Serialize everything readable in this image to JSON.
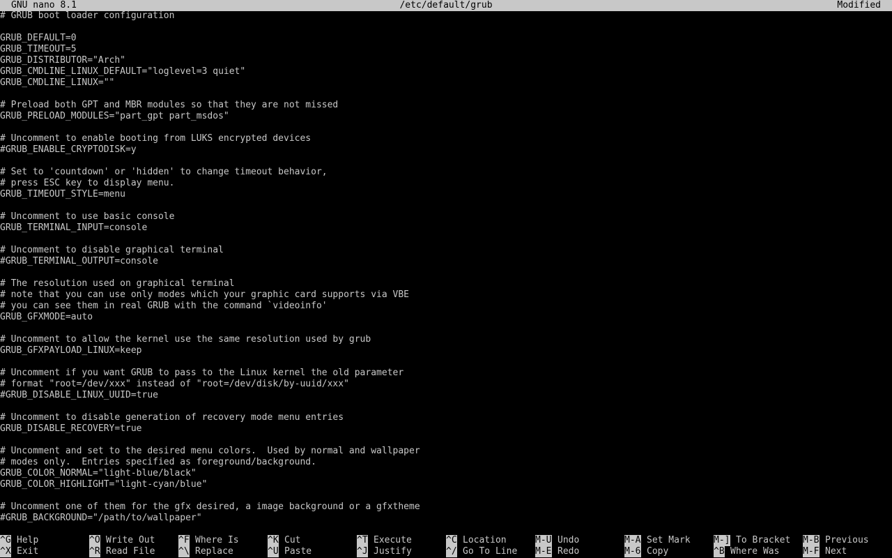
{
  "titlebar": {
    "app": "GNU nano 8.1",
    "file": "/etc/default/grub",
    "status": "Modified"
  },
  "editor": {
    "lines": [
      "# GRUB boot loader configuration",
      "",
      "GRUB_DEFAULT=0",
      "GRUB_TIMEOUT=5",
      "GRUB_DISTRIBUTOR=\"Arch\"",
      "GRUB_CMDLINE_LINUX_DEFAULT=\"loglevel=3 quiet\"",
      "GRUB_CMDLINE_LINUX=\"\"",
      "",
      "# Preload both GPT and MBR modules so that they are not missed",
      "GRUB_PRELOAD_MODULES=\"part_gpt part_msdos\"",
      "",
      "# Uncomment to enable booting from LUKS encrypted devices",
      "#GRUB_ENABLE_CRYPTODISK=y",
      "",
      "# Set to 'countdown' or 'hidden' to change timeout behavior,",
      "# press ESC key to display menu.",
      "GRUB_TIMEOUT_STYLE=menu",
      "",
      "# Uncomment to use basic console",
      "GRUB_TERMINAL_INPUT=console",
      "",
      "# Uncomment to disable graphical terminal",
      "#GRUB_TERMINAL_OUTPUT=console",
      "",
      "# The resolution used on graphical terminal",
      "# note that you can use only modes which your graphic card supports via VBE",
      "# you can see them in real GRUB with the command `videoinfo'",
      "GRUB_GFXMODE=auto",
      "",
      "# Uncomment to allow the kernel use the same resolution used by grub",
      "GRUB_GFXPAYLOAD_LINUX=keep",
      "",
      "# Uncomment if you want GRUB to pass to the Linux kernel the old parameter",
      "# format \"root=/dev/xxx\" instead of \"root=/dev/disk/by-uuid/xxx\"",
      "#GRUB_DISABLE_LINUX_UUID=true",
      "",
      "# Uncomment to disable generation of recovery mode menu entries",
      "GRUB_DISABLE_RECOVERY=true",
      "",
      "# Uncomment and set to the desired menu colors.  Used by normal and wallpaper",
      "# modes only.  Entries specified as foreground/background.",
      "GRUB_COLOR_NORMAL=\"light-blue/black\"",
      "GRUB_COLOR_HIGHLIGHT=\"light-cyan/blue\"",
      "",
      "# Uncomment one of them for the gfx desired, a image background or a gfxtheme",
      "#GRUB_BACKGROUND=\"/path/to/wallpaper\""
    ]
  },
  "shortcuts": {
    "row1": [
      {
        "key": "^G",
        "label": "Help"
      },
      {
        "key": "^O",
        "label": "Write Out"
      },
      {
        "key": "^F",
        "label": "Where Is"
      },
      {
        "key": "^K",
        "label": "Cut"
      },
      {
        "key": "^T",
        "label": "Execute"
      },
      {
        "key": "^C",
        "label": "Location"
      },
      {
        "key": "M-U",
        "label": "Undo"
      },
      {
        "key": "M-A",
        "label": "Set Mark"
      },
      {
        "key": "M-]",
        "label": "To Bracket"
      },
      {
        "key": "M-B",
        "label": "Previous"
      }
    ],
    "row2": [
      {
        "key": "^X",
        "label": "Exit"
      },
      {
        "key": "^R",
        "label": "Read File"
      },
      {
        "key": "^\\",
        "label": "Replace"
      },
      {
        "key": "^U",
        "label": "Paste"
      },
      {
        "key": "^J",
        "label": "Justify"
      },
      {
        "key": "^/",
        "label": "Go To Line"
      },
      {
        "key": "M-E",
        "label": "Redo"
      },
      {
        "key": "M-6",
        "label": "Copy"
      },
      {
        "key": "^B",
        "label": "Where Was"
      },
      {
        "key": "M-F",
        "label": "Next"
      }
    ]
  },
  "colors": {
    "background": "#000000",
    "foreground": "#c8c8c8",
    "highlight_bg": "#c8c8c8",
    "highlight_fg": "#000000"
  }
}
